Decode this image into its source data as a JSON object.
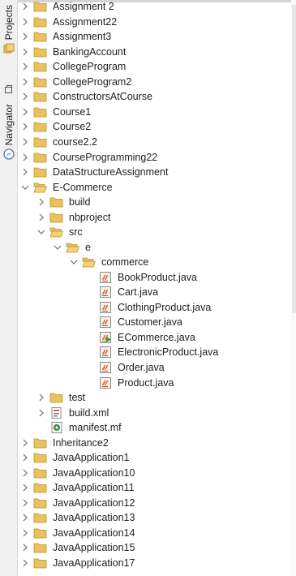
{
  "sidebar": {
    "projects_label": "Projects",
    "navigator_label": "Navigator"
  },
  "tree": [
    {
      "label": "Assignment 2",
      "level": 0,
      "kind": "folder",
      "state": "collapsed"
    },
    {
      "label": "Assignment22",
      "level": 0,
      "kind": "folder",
      "state": "collapsed"
    },
    {
      "label": "Assignment3",
      "level": 0,
      "kind": "folder",
      "state": "collapsed"
    },
    {
      "label": "BankingAccount",
      "level": 0,
      "kind": "folder",
      "state": "collapsed"
    },
    {
      "label": "CollegeProgram",
      "level": 0,
      "kind": "folder",
      "state": "collapsed"
    },
    {
      "label": "CollegeProgram2",
      "level": 0,
      "kind": "folder",
      "state": "collapsed"
    },
    {
      "label": "ConstructorsAtCourse",
      "level": 0,
      "kind": "folder",
      "state": "collapsed"
    },
    {
      "label": "Course1",
      "level": 0,
      "kind": "folder",
      "state": "collapsed"
    },
    {
      "label": "Course2",
      "level": 0,
      "kind": "folder",
      "state": "collapsed"
    },
    {
      "label": "course2.2",
      "level": 0,
      "kind": "folder",
      "state": "collapsed"
    },
    {
      "label": "CourseProgramming22",
      "level": 0,
      "kind": "folder",
      "state": "collapsed"
    },
    {
      "label": "DataStructureAssignment",
      "level": 0,
      "kind": "folder",
      "state": "collapsed"
    },
    {
      "label": "E-Commerce",
      "level": 0,
      "kind": "folder-open",
      "state": "expanded"
    },
    {
      "label": "build",
      "level": 1,
      "kind": "folder",
      "state": "collapsed"
    },
    {
      "label": "nbproject",
      "level": 1,
      "kind": "folder",
      "state": "collapsed"
    },
    {
      "label": "src",
      "level": 1,
      "kind": "folder-open",
      "state": "expanded"
    },
    {
      "label": "e",
      "level": 2,
      "kind": "folder-open",
      "state": "expanded"
    },
    {
      "label": "commerce",
      "level": 3,
      "kind": "folder-open",
      "state": "expanded"
    },
    {
      "label": "BookProduct.java",
      "level": 4,
      "kind": "java",
      "state": "leaf"
    },
    {
      "label": "Cart.java",
      "level": 4,
      "kind": "java",
      "state": "leaf"
    },
    {
      "label": "ClothingProduct.java",
      "level": 4,
      "kind": "java",
      "state": "leaf"
    },
    {
      "label": "Customer.java",
      "level": 4,
      "kind": "java",
      "state": "leaf"
    },
    {
      "label": "ECommerce.java",
      "level": 4,
      "kind": "java-main",
      "state": "leaf"
    },
    {
      "label": "ElectronicProduct.java",
      "level": 4,
      "kind": "java",
      "state": "leaf"
    },
    {
      "label": "Order.java",
      "level": 4,
      "kind": "java",
      "state": "leaf"
    },
    {
      "label": "Product.java",
      "level": 4,
      "kind": "java",
      "state": "leaf"
    },
    {
      "label": "test",
      "level": 1,
      "kind": "folder",
      "state": "collapsed"
    },
    {
      "label": "build.xml",
      "level": 1,
      "kind": "xml",
      "state": "collapsed"
    },
    {
      "label": "manifest.mf",
      "level": 1,
      "kind": "manifest",
      "state": "leaf"
    },
    {
      "label": "Inheritance2",
      "level": 0,
      "kind": "folder",
      "state": "collapsed"
    },
    {
      "label": "JavaApplication1",
      "level": 0,
      "kind": "folder",
      "state": "collapsed"
    },
    {
      "label": "JavaApplication10",
      "level": 0,
      "kind": "folder",
      "state": "collapsed"
    },
    {
      "label": "JavaApplication11",
      "level": 0,
      "kind": "folder",
      "state": "collapsed"
    },
    {
      "label": "JavaApplication12",
      "level": 0,
      "kind": "folder",
      "state": "collapsed"
    },
    {
      "label": "JavaApplication13",
      "level": 0,
      "kind": "folder",
      "state": "collapsed"
    },
    {
      "label": "JavaApplication14",
      "level": 0,
      "kind": "folder",
      "state": "collapsed"
    },
    {
      "label": "JavaApplication15",
      "level": 0,
      "kind": "folder",
      "state": "collapsed"
    },
    {
      "label": "JavaApplication17",
      "level": 0,
      "kind": "folder",
      "state": "collapsed"
    }
  ],
  "colors": {
    "folder": "#e7c25f",
    "folder_edge": "#b8912a",
    "java_icon": "#c7531e",
    "chevron": "#6d6d6d",
    "run_badge": "#2fa02f"
  }
}
